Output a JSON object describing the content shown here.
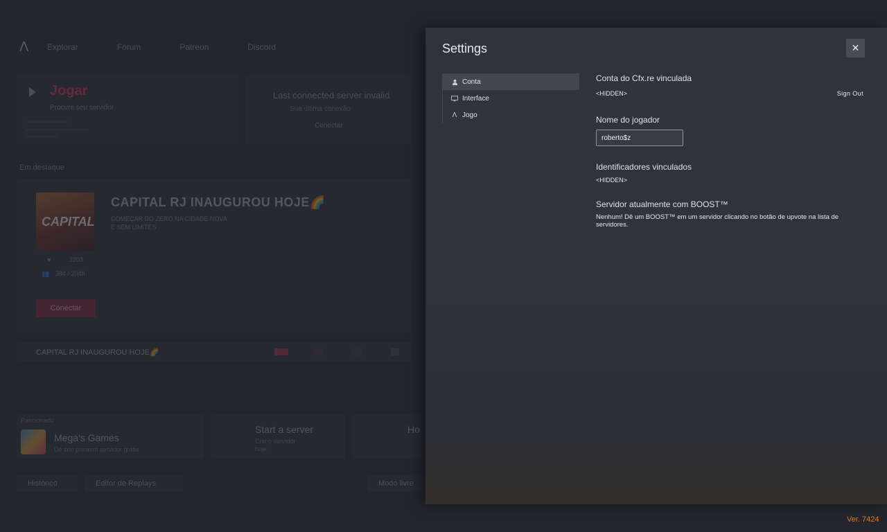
{
  "background": {
    "nav": [
      "Explorar",
      "Fórum",
      "Patreon",
      "Discord"
    ],
    "play": {
      "title": "Jogar",
      "subtitle": "Procure seu servidor"
    },
    "last_connected": {
      "title": "Last connected server invalid",
      "subtitle": "Sua última conexão",
      "link": "Conectar"
    },
    "featured_label": "Em destaque",
    "featured_server": {
      "thumb_text": "CAPITAL",
      "title": "CAPITAL RJ INAUGUROU HOJE🌈",
      "description_lines": [
        "COMEÇAR DO ZERO NA CIDADE NOVA",
        "E SEM LIMITES"
      ],
      "likes": "3203",
      "players": "384 / 2048",
      "connect_label": "Conectar"
    },
    "server_bar_text": "CAPITAL RJ INAUGUROU HOJE🌈",
    "mega": {
      "label": "Patrocinado",
      "title": "Mega's Games",
      "subtitle": "Dê seu primeiro servidor grátis"
    },
    "start": {
      "title": "Start a server",
      "subtitle_lines": [
        "Crie o servidor",
        "hoje"
      ]
    },
    "host": {
      "title": "Ho"
    },
    "bottom_buttons": [
      "Histórico",
      "Editor de Replays",
      "Modo livre"
    ]
  },
  "settings": {
    "title": "Settings",
    "close_icon": "close-icon",
    "nav": [
      {
        "icon": "user-icon",
        "label": "Conta",
        "active": true
      },
      {
        "icon": "monitor-icon",
        "label": "Interface",
        "active": false
      },
      {
        "icon": "game-logo-icon",
        "label": "Jogo",
        "active": false
      }
    ],
    "account": {
      "linked_title": "Conta do Cfx.re vinculada",
      "linked_value": "<HIDDEN>",
      "sign_out": "Sign Out",
      "player_name_title": "Nome do jogador",
      "player_name_value": "roberto$z",
      "identifiers_title": "Identificadores vinculados",
      "identifiers_value": "<HIDDEN>",
      "boost_title": "Servidor atualmente com BOOST™",
      "boost_text": "Nenhum! Dê um BOOST™ em um servidor clicando no botão de upvote na lista de servidores."
    }
  },
  "version": "Ver. 7424",
  "colors": {
    "accent": "#e7335c",
    "version": "#e07b24",
    "modal_bg": "#31333b"
  }
}
